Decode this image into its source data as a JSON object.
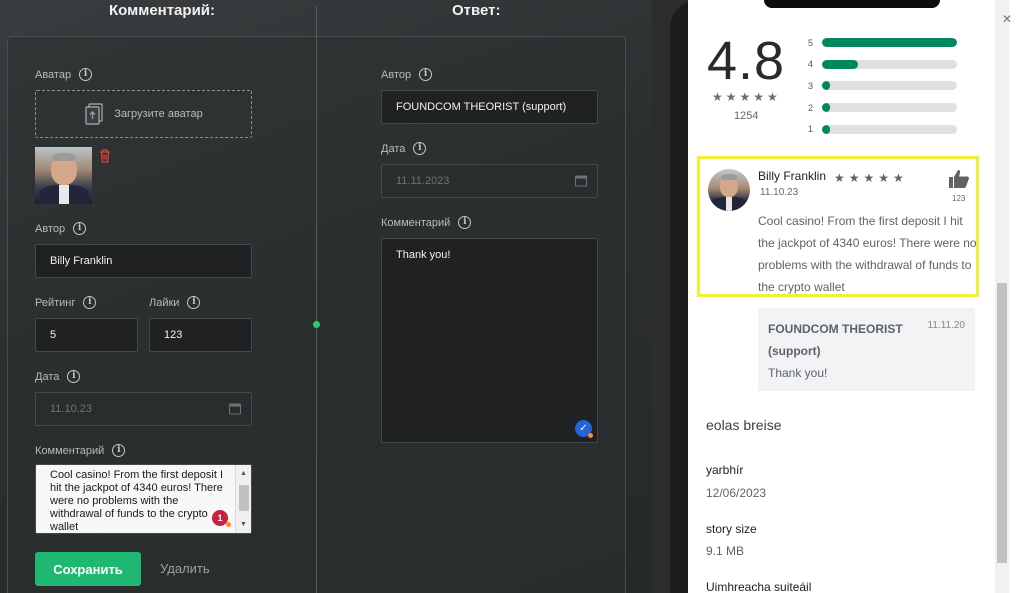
{
  "editor": {
    "comment_heading": "Комментарий:",
    "reply_heading": "Ответ:",
    "avatar_label": "Аватар",
    "upload_avatar": "Загрузите аватар",
    "author_label": "Автор",
    "author_value": "Billy Franklin",
    "rating_label": "Рейтинг",
    "rating_value": "5",
    "likes_label": "Лайки",
    "likes_value": "123",
    "date_label": "Дата",
    "date_placeholder": "11.10.23",
    "comment_label": "Комментарий",
    "comment_value": "Cool casino! From the first deposit I hit the jackpot of 4340 euros! There were no problems with the withdrawal of funds to the crypto wallet",
    "spell_badge": "1",
    "save_button": "Сохранить",
    "delete_button": "Удалить",
    "reply_author_label": "Автор",
    "reply_author_value": "FOUNDCOM THEORIST (support)",
    "reply_date_label": "Дата",
    "reply_date_placeholder": "11.11.2023",
    "reply_comment_label": "Комментарий",
    "reply_comment_value": "Thank you!"
  },
  "preview": {
    "rating": "4.8",
    "stars": "★★★★★",
    "rating_count": "1254",
    "bars": [
      {
        "label": "5",
        "fill": 1.0
      },
      {
        "label": "4",
        "fill": 0.27
      },
      {
        "label": "3",
        "fill": 0.06
      },
      {
        "label": "2",
        "fill": 0.06
      },
      {
        "label": "1",
        "fill": 0.06
      }
    ],
    "review": {
      "name": "Billy Franklin",
      "date": "11.10.23",
      "stars": "★★★★★",
      "likes": "123",
      "text": "Cool casino! From the first deposit I hit the jackpot of 4340 euros! There were no problems with the withdrawal of funds to the crypto wallet"
    },
    "reply": {
      "author": "FOUNDCOM THEORIST (support)",
      "date": "11.11.20",
      "text": "Thank you!"
    },
    "info_title": "eolas breise",
    "version_label": "yarbhír",
    "version_value": "12/06/2023",
    "size_label": "story size",
    "size_value": "9.1 MB",
    "compat_label": "Uimhreacha suiteáil"
  },
  "colors": {
    "accent_green": "#1fb872",
    "bar_green": "#01875f",
    "highlight_yellow": "#f0ef3a",
    "delete_red": "#e0413b"
  }
}
